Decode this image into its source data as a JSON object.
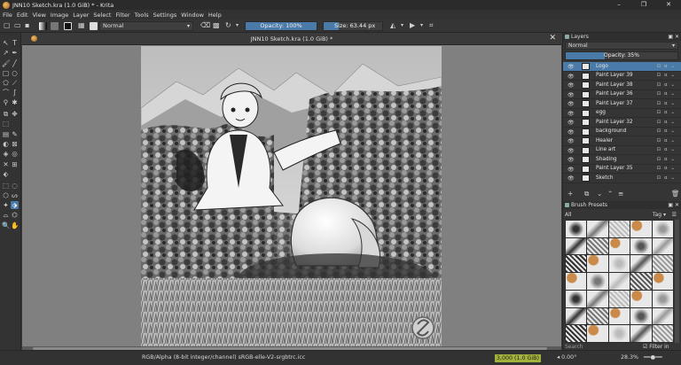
{
  "window": {
    "title": "JNN10 Sketch.kra (1.0 GiB) * - Krita",
    "controls": [
      "–",
      "❐",
      "✕"
    ]
  },
  "menu": [
    "File",
    "Edit",
    "View",
    "Image",
    "Layer",
    "Select",
    "Filter",
    "Tools",
    "Settings",
    "Window",
    "Help"
  ],
  "tool_options": {
    "blend_mode": "Normal",
    "opacity_label": "Opacity: 100%",
    "size_label": "Size: 63.44 px",
    "size_fraction": 0.25
  },
  "document": {
    "tab_title": "JNN10 Sketch.kra (1.0 GiB) *",
    "close_glyph": "✕"
  },
  "layers_docker": {
    "title": "Layers",
    "blend_mode": "Normal",
    "opacity_label": "Opacity:  35%",
    "opacity_fraction": 0.35,
    "layers": [
      {
        "name": "Logo",
        "active": true
      },
      {
        "name": "Paint Layer 39",
        "active": false
      },
      {
        "name": "Paint Layer 38",
        "active": false
      },
      {
        "name": "Paint Layer 36",
        "active": false
      },
      {
        "name": "Paint Layer 37",
        "active": false
      },
      {
        "name": "egg",
        "active": false
      },
      {
        "name": "Paint Layer 32",
        "active": false
      },
      {
        "name": "background",
        "active": false
      },
      {
        "name": "Healer",
        "active": false
      },
      {
        "name": "Line art",
        "active": false
      },
      {
        "name": "Shading",
        "active": false
      },
      {
        "name": "Paint Layer 35",
        "active": false
      },
      {
        "name": "Sketch",
        "active": false
      }
    ],
    "actions": [
      "+",
      "⧉",
      "⌄",
      "⌃",
      "≡",
      "🗑"
    ]
  },
  "brush_docker": {
    "title": "Brush Presets",
    "filter": "All",
    "tag_label": "Tag",
    "search_placeholder": "Search",
    "filter_in_tag": "Filter in Tag"
  },
  "status": {
    "color_info": "RGB/Alpha (8-bit integer/channel)  sRGB-elle-V2-srgbtrc.icc",
    "memory": "3,000 (1.0 GiB)",
    "rotation": "0.00°",
    "zoom": "28.3%"
  },
  "colors": {
    "accent": "#4a7aa8",
    "memory_badge": "#a4b23c"
  }
}
